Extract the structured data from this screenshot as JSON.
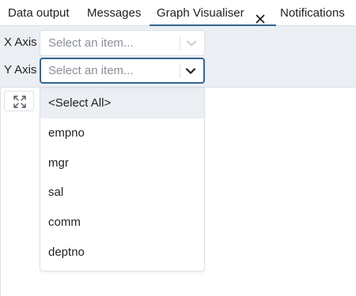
{
  "tabs": [
    {
      "label": "Data output"
    },
    {
      "label": "Messages"
    },
    {
      "label": "Graph Visualiser",
      "active": true,
      "closable": true
    },
    {
      "label": "Notifications"
    }
  ],
  "axes": {
    "x": {
      "label": "X Axis",
      "placeholder": "Select an item..."
    },
    "y": {
      "label": "Y Axis",
      "placeholder": "Select an item..."
    }
  },
  "dropdown": {
    "options": [
      "<Select All>",
      "empno",
      "mgr",
      "sal",
      "comm",
      "deptno"
    ],
    "highlighted": "<Select All>"
  },
  "icons": {
    "tab_close": "close-icon",
    "chevron": "chevron-down-icon",
    "zoom": "expand-icon"
  },
  "colors": {
    "accent": "#326690",
    "panel_bg": "#ebeef3",
    "border": "#dde0e6",
    "placeholder": "#8a8f98"
  }
}
